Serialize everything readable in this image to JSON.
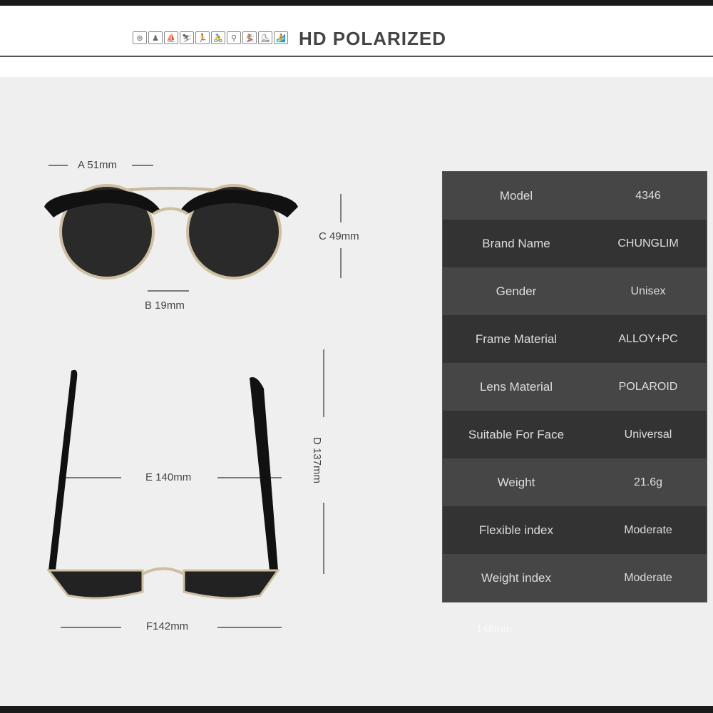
{
  "header": {
    "title": "HD POLARIZED",
    "icons": [
      "steering-wheel",
      "golf",
      "fishing",
      "skiing",
      "running",
      "cycling-race",
      "cycling",
      "snowboard",
      "skateboard",
      "surfing"
    ]
  },
  "dimensions": {
    "a": "A 51mm",
    "b": "B 19mm",
    "c": "C 49mm",
    "d": "D 137mm",
    "e": "E 140mm",
    "f": "F142mm",
    "ghost": "148mm"
  },
  "specs": [
    {
      "label": "Model",
      "value": "4346"
    },
    {
      "label": "Brand Name",
      "value": "CHUNGLIM"
    },
    {
      "label": "Gender",
      "value": "Unisex"
    },
    {
      "label": "Frame Material",
      "value": "ALLOY+PC"
    },
    {
      "label": "Lens Material",
      "value": "POLAROID"
    },
    {
      "label": "Suitable For Face",
      "value": "Universal"
    },
    {
      "label": "Weight",
      "value": "21.6g"
    },
    {
      "label": "Flexible index",
      "value": "Moderate"
    },
    {
      "label": "Weight index",
      "value": "Moderate"
    }
  ]
}
